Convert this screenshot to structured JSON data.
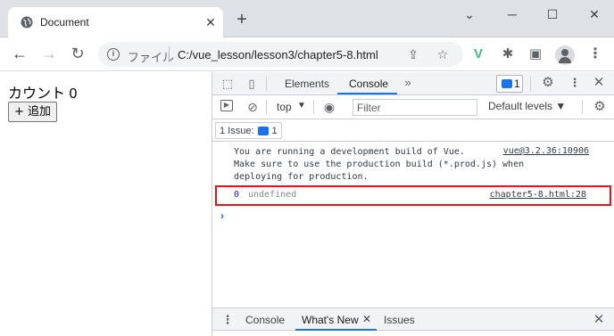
{
  "browser": {
    "tab_title": "Document",
    "tab_close": "✕",
    "new_tab": "+",
    "scheme_label": "ファイル",
    "url": "C:/vue_lesson/lesson3/chapter5-8.html"
  },
  "page": {
    "count_label": "カウント 0",
    "add_button": "+ 追加"
  },
  "devtools": {
    "tabs": [
      "Elements",
      "Console"
    ],
    "active_tab": "Console",
    "more_tabs": "»",
    "message_count": "1",
    "context": "top",
    "filter_placeholder": "Filter",
    "levels": "Default levels ▼",
    "issues_label": "1 Issue:",
    "issues_count": "1",
    "log1_text": "You are running a development build of Vue.\nMake sure to use the production build (*.prod.js) when\ndeploying for production.",
    "log1_source": "vue@3.2.36:10906",
    "log2_value": "0",
    "log2_rest": "undefined",
    "log2_source": "chapter5-8.html:28",
    "prompt": "›"
  },
  "drawer": {
    "tabs": [
      "Console",
      "What's New",
      "Issues"
    ],
    "active_tab": "What's New"
  },
  "colors": {
    "accent": "#1a73e8",
    "highlight_border": "#e4141b",
    "vue_green": "#41b883"
  },
  "icons": {
    "tab_favicon": "globe-icon",
    "inspect": "inspect-element-icon",
    "device": "device-toolbar-icon",
    "settings": "gear-icon"
  }
}
